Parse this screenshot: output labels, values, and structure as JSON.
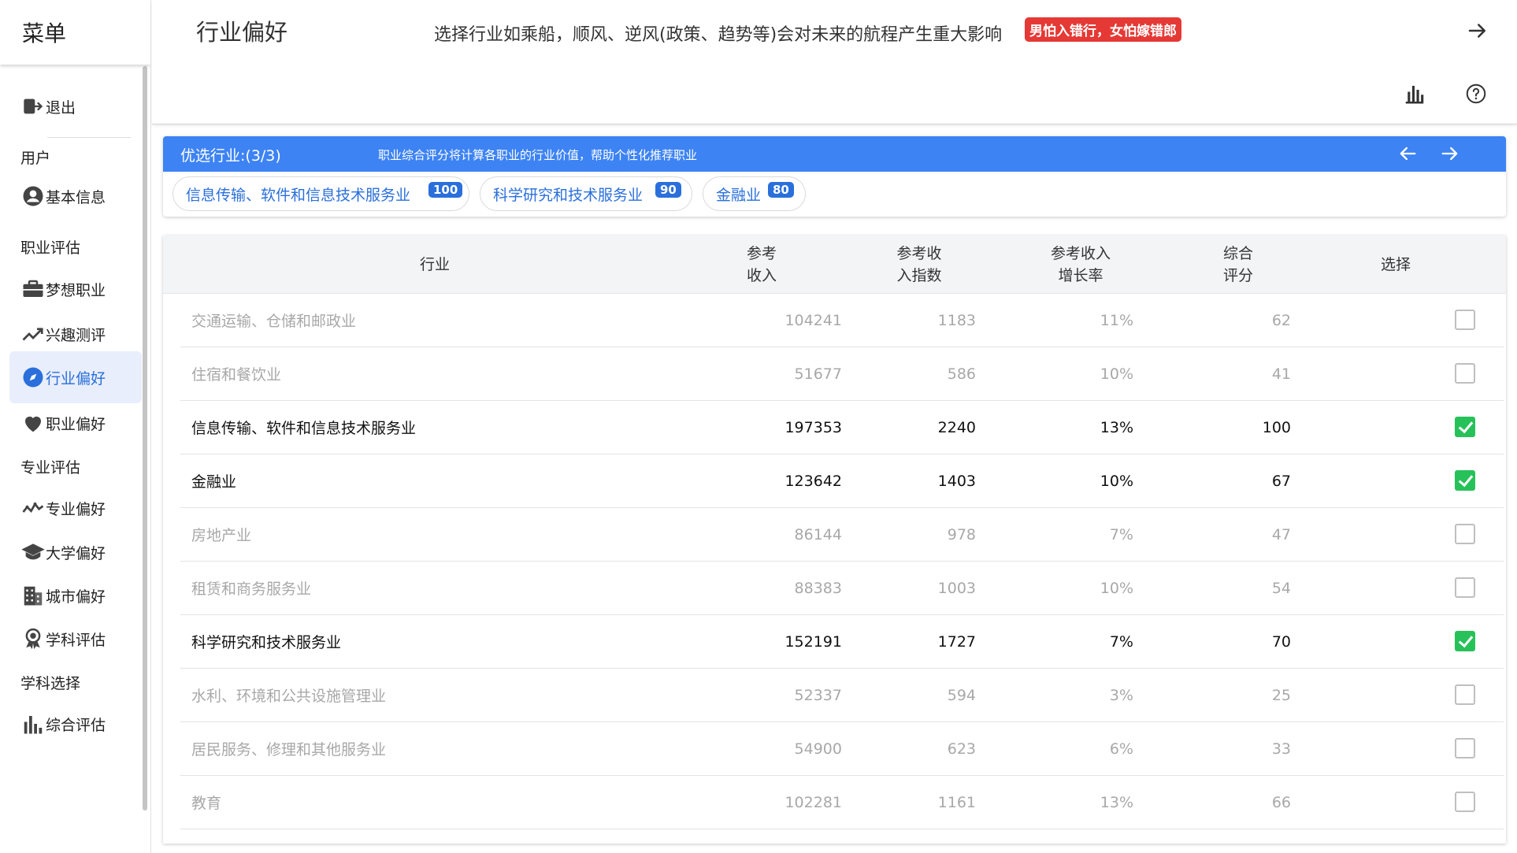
{
  "sidebar": {
    "title": "菜单",
    "items": [
      {
        "label": "退出",
        "icon": "logout-icon"
      },
      {
        "section": "用户"
      },
      {
        "label": "基本信息",
        "icon": "account-icon"
      },
      {
        "section": "职业评估"
      },
      {
        "label": "梦想职业",
        "icon": "briefcase-icon"
      },
      {
        "label": "兴趣测评",
        "icon": "trend-icon"
      },
      {
        "label": "行业偏好",
        "icon": "compass-icon",
        "active": true
      },
      {
        "label": "职业偏好",
        "icon": "heart-icon"
      },
      {
        "section": "专业评估"
      },
      {
        "label": "专业偏好",
        "icon": "wave-icon"
      },
      {
        "label": "大学偏好",
        "icon": "mortarboard-icon"
      },
      {
        "label": "城市偏好",
        "icon": "building-icon"
      },
      {
        "label": "学科评估",
        "icon": "award-icon"
      },
      {
        "section": "学科选择"
      },
      {
        "label": "综合评估",
        "icon": "bar-chart-icon"
      }
    ]
  },
  "header": {
    "title": "行业偏好",
    "subtitle": "选择行业如乘船，顺风、逆风(政策、趋势等)会对未来的航程产生重大影响",
    "slogan": "男怕入错行，女怕嫁错郎"
  },
  "preferred": {
    "title": "优选行业:(3/3)",
    "description": "职业综合评分将计算各职业的行业价值，帮助个性化推荐职业",
    "chips": [
      {
        "label": "信息传输、软件和信息技术服务业",
        "score": "100"
      },
      {
        "label": "科学研究和技术服务业",
        "score": "90"
      },
      {
        "label": "金融业",
        "score": "80"
      }
    ]
  },
  "table": {
    "headers": {
      "industry": "行业",
      "income": [
        "参考",
        "收入"
      ],
      "index": [
        "参考收",
        "入指数"
      ],
      "growth": [
        "参考收入",
        "增长率"
      ],
      "score": [
        "综合",
        "评分"
      ],
      "select": "选择"
    },
    "rows": [
      {
        "name": "交通运输、仓储和邮政业",
        "income": "104241",
        "index": "1183",
        "growth": "11%",
        "score": "62",
        "selected": false
      },
      {
        "name": "住宿和餐饮业",
        "income": "51677",
        "index": "586",
        "growth": "10%",
        "score": "41",
        "selected": false
      },
      {
        "name": "信息传输、软件和信息技术服务业",
        "income": "197353",
        "index": "2240",
        "growth": "13%",
        "score": "100",
        "selected": true
      },
      {
        "name": "金融业",
        "income": "123642",
        "index": "1403",
        "growth": "10%",
        "score": "67",
        "selected": true
      },
      {
        "name": "房地产业",
        "income": "86144",
        "index": "978",
        "growth": "7%",
        "score": "47",
        "selected": false
      },
      {
        "name": "租赁和商务服务业",
        "income": "88383",
        "index": "1003",
        "growth": "10%",
        "score": "54",
        "selected": false
      },
      {
        "name": "科学研究和技术服务业",
        "income": "152191",
        "index": "1727",
        "growth": "7%",
        "score": "70",
        "selected": true
      },
      {
        "name": "水利、环境和公共设施管理业",
        "income": "52337",
        "index": "594",
        "growth": "3%",
        "score": "25",
        "selected": false
      },
      {
        "name": "居民服务、修理和其他服务业",
        "income": "54900",
        "index": "623",
        "growth": "6%",
        "score": "33",
        "selected": false
      },
      {
        "name": "教育",
        "income": "102281",
        "index": "1161",
        "growth": "13%",
        "score": "66",
        "selected": false
      }
    ]
  },
  "colors": {
    "primary": "#3d83f4",
    "accent": "#2a6fdb",
    "slogan": "#e53935",
    "check": "#27c15a"
  }
}
